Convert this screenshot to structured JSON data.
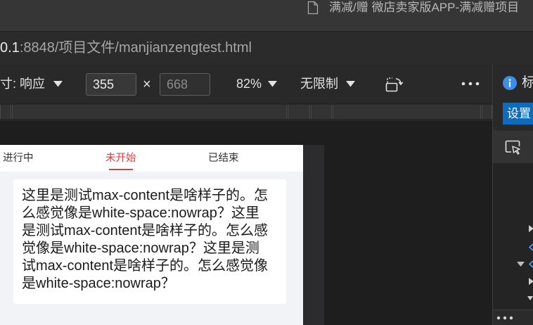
{
  "colors": {
    "accent_red": "#e4393c",
    "button_blue": "#0f6cbd",
    "info_blue": "#3b8eea",
    "tree_blue": "#4aa3ff"
  },
  "window": {
    "title": "满减/赠 微店卖家版APP-满减赠项目",
    "title_icon": "document-icon"
  },
  "address_bar": {
    "host": "0.1",
    "path": ":8848/项目文件/manjianzengtest.html"
  },
  "device_toolbar": {
    "dimensions_label": "寸: 响应",
    "width_value": "355",
    "dimension_separator": "×",
    "height_placeholder": "668",
    "zoom_label": "82%",
    "throttling_label": "无限制",
    "icons": {
      "dropdown": "caret-down-icon",
      "rotate": "rotate-icon",
      "more": "more-horizontal-icon"
    }
  },
  "emulated_page": {
    "tabs": [
      {
        "label": "进行中",
        "active": false
      },
      {
        "label": "未开始",
        "active": true
      },
      {
        "label": "已结束",
        "active": false
      }
    ],
    "card_lines": [
      "这里是测试max-content是啥样子的。怎",
      "么感觉像是white-space:nowrap？这里",
      "是测试max-content是啥样子的。怎么感",
      "觉像是white-space:nowrap？这里是测",
      "试max-content是啥样子的。怎么感觉像",
      "是white-space:nowrap？"
    ]
  },
  "side_panel": {
    "info_icon": "info-icon",
    "heading_partial": "标",
    "button_label": "设置",
    "inspect_icon": "inspect-element-icon",
    "tree_icons": [
      "expand-arrow-icon",
      "tag-bracket-icon",
      "collapse-arrow-icon",
      "tag-bracket-icon",
      "expand-arrow-icon",
      "collapse-arrow-icon"
    ],
    "more_icon": "more-horizontal-icon"
  }
}
